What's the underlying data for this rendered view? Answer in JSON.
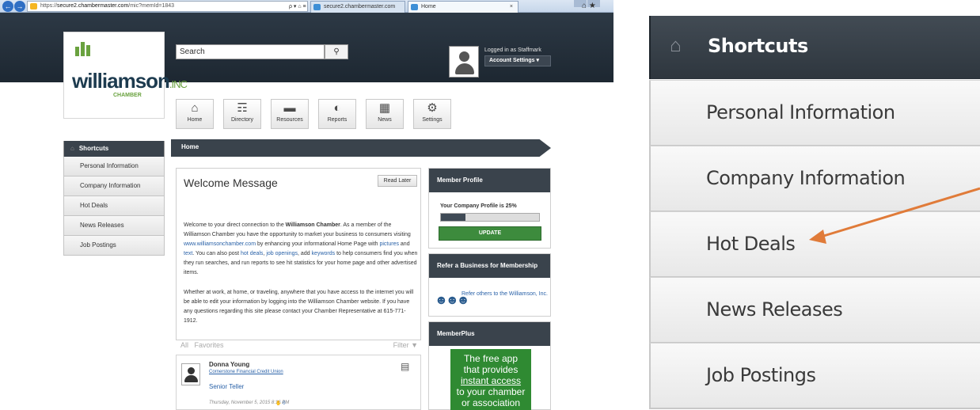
{
  "browser": {
    "url_prefix": "https://",
    "url_host": "secure2.chambermaster.com",
    "url_path": "/mic?memId=1843",
    "addr_tools": "ρ ▾ ⌂ ≡ C",
    "tab1_title": "secure2.chambermaster.com",
    "tab2_title": "Home",
    "tab2_close": "×",
    "right_icons": "⌂ ★"
  },
  "header": {
    "logo_main": "williamson",
    "logo_inc": ".INC",
    "logo_sub": "CHAMBER",
    "search_placeholder": "Search",
    "search_icon": "search-icon",
    "logged_in": "Logged in as Staffmark",
    "account_settings": "Account Settings ▾"
  },
  "nav": [
    {
      "label": "Home",
      "icon": "⌂"
    },
    {
      "label": "Directory",
      "icon": "☶"
    },
    {
      "label": "Resources",
      "icon": "▬"
    },
    {
      "label": "Reports",
      "icon": "◐"
    },
    {
      "label": "News",
      "icon": "▦"
    },
    {
      "label": "Settings",
      "icon": "⚙"
    }
  ],
  "sidebar": {
    "title": "Shortcuts",
    "items": [
      "Personal Information",
      "Company Information",
      "Hot Deals",
      "News Releases",
      "Job Postings"
    ]
  },
  "breadcrumb": "Home",
  "welcome": {
    "title": "Welcome Message",
    "read_later": "Read Later",
    "p1_a": "Welcome to your direct connection to the ",
    "p1_b": "Williamson Chamber",
    "p1_c": ". As a member of the Williamson Chamber you have the opportunity to market your business to consumers visiting ",
    "p1_link1": "www.williamsonchamber.com",
    "p1_d": " by enhancing your informational Home Page with ",
    "p1_link2": "pictures",
    "p1_e": " and ",
    "p1_link3": "text",
    "p1_f": ". You can also post ",
    "p1_link4": "hot deals",
    "p1_g": ", ",
    "p1_link5": "job openings",
    "p1_h": ", add ",
    "p1_link6": "keywords",
    "p1_i": " to help consumers find you when they run searches, and run reports to see hit statistics for your home page and other advertised items.",
    "p2": "Whether at work, at home, or traveling, anywhere that you have access to the internet you will be able to edit your information by logging into the Williamson Chamber website. If you have any questions regarding this site please contact your Chamber Representative at 615-771-1912."
  },
  "feed": {
    "tab_all": "All",
    "tab_favorites": "Favorites",
    "filter": "Filter ▼",
    "name": "Donna Young",
    "company": "Cornerstone Financial Credit Union",
    "role": "Senior Teller",
    "date": "Thursday, November 5, 2015 8:16 PM",
    "likes": "0"
  },
  "member_profile": {
    "title": "Member Profile",
    "progress_text": "Your Company Profile is 25%",
    "progress": 0.25,
    "update": "UPDATE"
  },
  "refer": {
    "title": "Refer a Business for Membership",
    "text": "Refer others to the Williamson, Inc."
  },
  "memberplus": {
    "title": "MemberPlus",
    "line1": "The free app",
    "line2": "that provides",
    "line3": "instant access",
    "line4": "to your chamber",
    "line5": "or association"
  },
  "zoom": {
    "title": "Shortcuts",
    "items": [
      "Personal Information",
      "Company Information",
      "Hot Deals",
      "News Releases",
      "Job Postings"
    ]
  },
  "colors": {
    "header_dark": "#2d3945",
    "accent_green": "#3d8b3d",
    "arrow": "#e07b39"
  }
}
